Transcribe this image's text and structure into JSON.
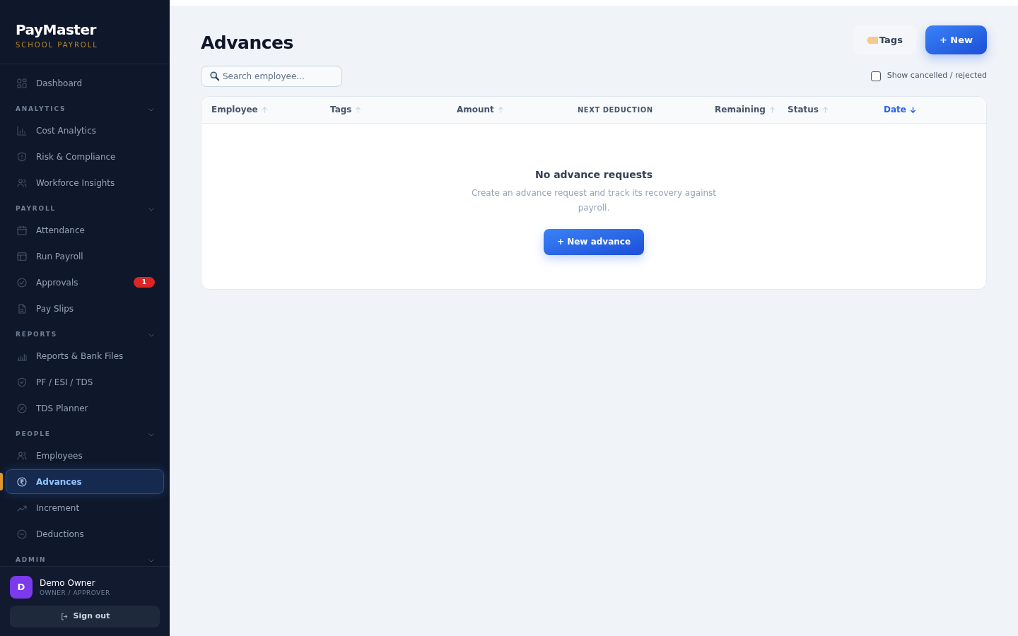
{
  "brand": {
    "name": "PayMaster",
    "tagline": "SCHOOL PAYROLL"
  },
  "nav": [
    {
      "kind": "item",
      "label": "Dashboard",
      "selected": false
    },
    {
      "kind": "section",
      "label": "ANALYTICS",
      "expanded": true
    },
    {
      "kind": "item",
      "label": "Cost Analytics",
      "selected": false
    },
    {
      "kind": "item",
      "label": "Risk & Compliance",
      "selected": false
    },
    {
      "kind": "item",
      "label": "Workforce Insights",
      "selected": false
    },
    {
      "kind": "section",
      "label": "PAYROLL",
      "expanded": true
    },
    {
      "kind": "item",
      "label": "Attendance",
      "selected": false
    },
    {
      "kind": "item",
      "label": "Run Payroll",
      "selected": false
    },
    {
      "kind": "item",
      "label": "Approvals",
      "selected": false,
      "badge": "1"
    },
    {
      "kind": "item",
      "label": "Pay Slips",
      "selected": false
    },
    {
      "kind": "section",
      "label": "REPORTS",
      "expanded": true
    },
    {
      "kind": "item",
      "label": "Reports & Bank Files",
      "selected": false
    },
    {
      "kind": "item",
      "label": "PF / ESI / TDS",
      "selected": false
    },
    {
      "kind": "item",
      "label": "TDS Planner",
      "selected": false
    },
    {
      "kind": "section",
      "label": "PEOPLE",
      "expanded": true
    },
    {
      "kind": "item",
      "label": "Employees",
      "selected": false
    },
    {
      "kind": "item",
      "label": "Advances",
      "selected": true
    },
    {
      "kind": "item",
      "label": "Increment",
      "selected": false
    },
    {
      "kind": "item",
      "label": "Deductions",
      "selected": false
    },
    {
      "kind": "section",
      "label": "ADMIN",
      "expanded": true
    }
  ],
  "user": {
    "initial": "D",
    "name": "Demo Owner",
    "role": "OWNER / APPROVER",
    "sign_out": "Sign out"
  },
  "page": {
    "title": "Advances",
    "tags_button": "Tags",
    "new_button": "+ New"
  },
  "search": {
    "placeholder": "Search employee..."
  },
  "filter": {
    "label": "Show cancelled / rejected",
    "checked": false
  },
  "table": {
    "columns": [
      {
        "label": "Employee",
        "sortable": true,
        "selected": false
      },
      {
        "label": "Tags",
        "sortable": true,
        "selected": false
      },
      {
        "label": "Amount",
        "sortable": true,
        "selected": false
      },
      {
        "label": "NEXT DEDUCTION",
        "sortable": false,
        "selected": false
      },
      {
        "label": "Remaining",
        "sortable": true,
        "selected": false
      },
      {
        "label": "Status",
        "sortable": true,
        "selected": false
      },
      {
        "label": "Date",
        "sortable": true,
        "selected": true
      }
    ]
  },
  "empty_state": {
    "title": "No advance requests",
    "text": "Create an advance request and track its recovery against payroll.",
    "button": "+ New advance"
  }
}
